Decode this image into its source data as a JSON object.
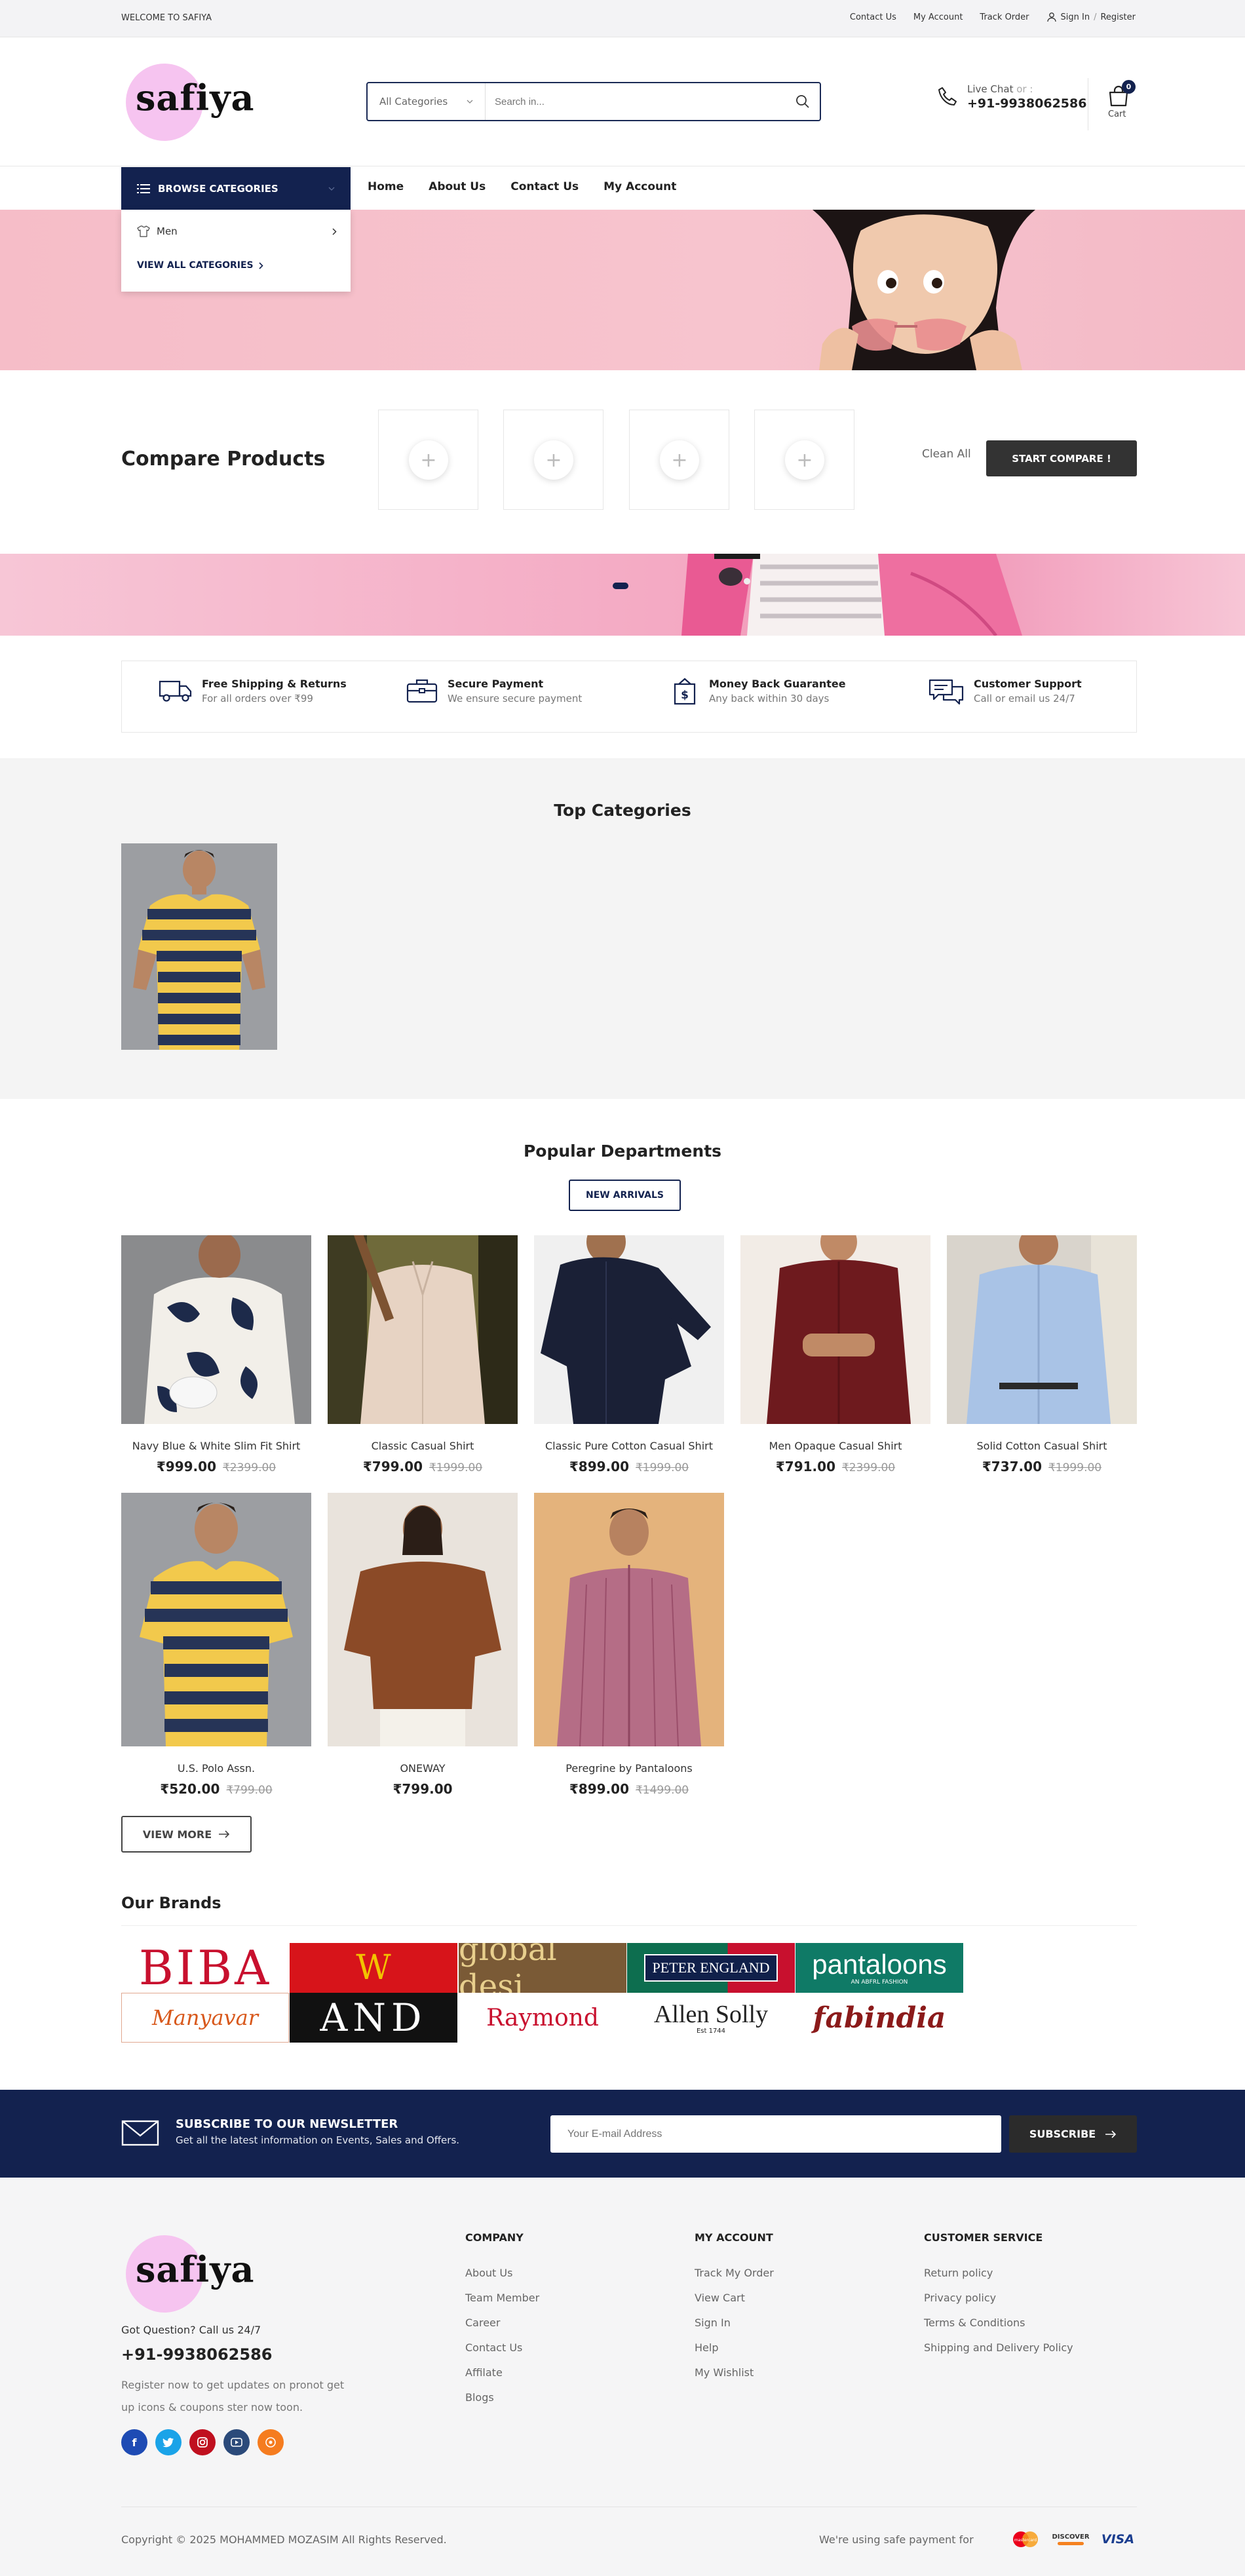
{
  "topbar": {
    "welcome": "WELCOME TO SAFIYA",
    "links": [
      "Contact Us",
      "My Account",
      "Track Order"
    ],
    "signin": "Sign In",
    "separator": "/",
    "register": "Register"
  },
  "header": {
    "logo_text": "safiya",
    "search_category": "All Categories",
    "search_placeholder": "Search in...",
    "live_chat_label": "Live Chat",
    "live_chat_or": "or :",
    "phone": "+91-9938062586",
    "cart_count": "0",
    "cart_label": "Cart"
  },
  "nav": {
    "browse_label": "BROWSE CATEGORIES",
    "links": [
      "Home",
      "About Us",
      "Contact Us",
      "My Account"
    ],
    "categories": [
      "Men"
    ],
    "view_all": "VIEW ALL CATEGORIES"
  },
  "compare": {
    "title": "Compare Products",
    "clean_all": "Clean All",
    "start": "START COMPARE !"
  },
  "features": [
    {
      "icon": "truck-icon",
      "title": "Free Shipping & Returns",
      "subtitle": "For all orders over ₹99"
    },
    {
      "icon": "briefcase-icon",
      "title": "Secure Payment",
      "subtitle": "We ensure secure payment"
    },
    {
      "icon": "money-back-icon",
      "title": "Money Back Guarantee",
      "subtitle": "Any back within 30 days"
    },
    {
      "icon": "chat-support-icon",
      "title": "Customer Support",
      "subtitle": "Call or email us 24/7"
    }
  ],
  "top_categories": {
    "title": "Top Categories"
  },
  "popular": {
    "title": "Popular Departments",
    "tab": "NEW ARRIVALS",
    "products": [
      {
        "name": "Navy Blue & White Slim Fit Shirt",
        "price": "₹999.00",
        "old_price": "₹2399.00"
      },
      {
        "name": "Classic Casual Shirt",
        "price": "₹799.00",
        "old_price": "₹1999.00"
      },
      {
        "name": "Classic Pure Cotton Casual Shirt",
        "price": "₹899.00",
        "old_price": "₹1999.00"
      },
      {
        "name": "Men Opaque Casual Shirt",
        "price": "₹791.00",
        "old_price": "₹2399.00"
      },
      {
        "name": "Solid Cotton Casual Shirt",
        "price": "₹737.00",
        "old_price": "₹1999.00"
      },
      {
        "name": "U.S. Polo Assn.",
        "price": "₹520.00",
        "old_price": "₹799.00"
      },
      {
        "name": "ONEWAY",
        "price": "₹799.00",
        "old_price": ""
      },
      {
        "name": "Peregrine by Pantaloons",
        "price": "₹899.00",
        "old_price": "₹1499.00"
      }
    ],
    "view_more": "VIEW MORE"
  },
  "brands": {
    "title": "Our Brands",
    "items": [
      "BIBA",
      "W",
      "global desi",
      "PETER ENGLAND",
      "pantaloons",
      "Manyavar",
      "AND",
      "Raymond",
      "Allen Solly",
      "fabindia"
    ],
    "pantaloons_sub": "AN ABFRL FASHION",
    "allen_sub": "Est 1744"
  },
  "newsletter": {
    "title": "SUBSCRIBE TO OUR NEWSLETTER",
    "subtitle": "Get all the latest information on Events, Sales and Offers.",
    "placeholder": "Your E-mail Address",
    "button": "SUBSCRIBE"
  },
  "footer": {
    "logo_text": "safiya",
    "got_question": "Got Question? Call us 24/7",
    "phone": "+91-9938062586",
    "register_text": "Register now to get updates on pronot get up icons & coupons ster now toon.",
    "columns": [
      {
        "title": "COMPANY",
        "links": [
          "About Us",
          "Team Member",
          "Career",
          "Contact Us",
          "Affilate",
          "Blogs"
        ]
      },
      {
        "title": "MY ACCOUNT",
        "links": [
          "Track My Order",
          "View Cart",
          "Sign In",
          "Help",
          "My Wishlist"
        ]
      },
      {
        "title": "CUSTOMER SERVICE",
        "links": [
          "Return policy",
          "Privacy policy",
          "Terms & Conditions",
          "Shipping and Delivery Policy"
        ]
      }
    ],
    "copyright": "Copyright © 2025 MOHAMMED MOZASIM All Rights Reserved.",
    "safe_payment": "We're using safe payment for",
    "payments": [
      "mastercard",
      "DISCOVER",
      "VISA"
    ]
  },
  "colors": {
    "navy": "#13224f",
    "logo_pink": "#f6c4f0",
    "hero_pink": "#f6bdc8"
  }
}
